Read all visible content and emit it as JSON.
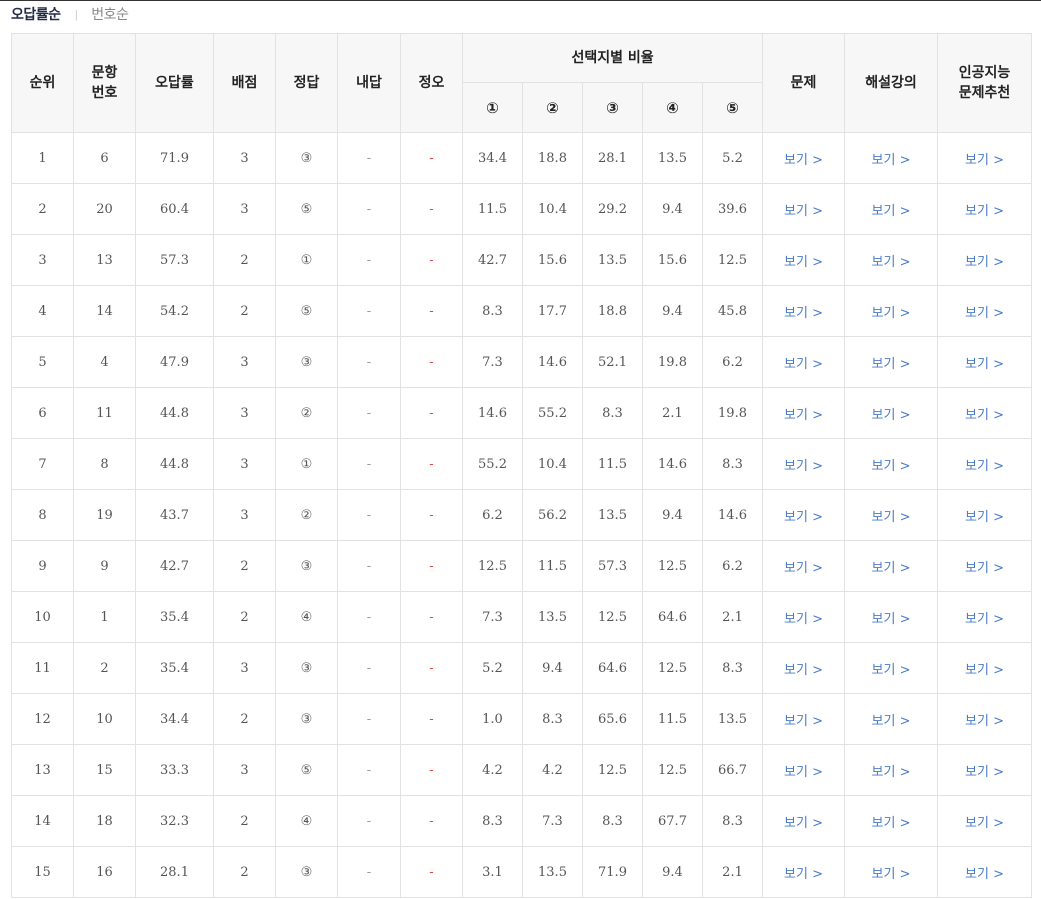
{
  "sort_tabs": {
    "active": "오답률순",
    "separator": "|",
    "inactive": "번호순"
  },
  "headers": {
    "rank": "순위",
    "question_no": "문항\n번호",
    "wrong_rate": "오답률",
    "points": "배점",
    "answer": "정답",
    "my_answer": "내답",
    "correctness": "정오",
    "choice_ratio": "선택지별 비율",
    "choices": [
      "①",
      "②",
      "③",
      "④",
      "⑤"
    ],
    "problem": "문제",
    "lecture": "해설강의",
    "ai_recommend": "인공지능\n문제추천"
  },
  "link_label": "보기 >",
  "rows": [
    {
      "rank": "1",
      "q": "6",
      "wrong": "71.9",
      "pts": "3",
      "ans": "③",
      "mine": "-",
      "ox": "-",
      "r": [
        "34.4",
        "18.8",
        "28.1",
        "13.5",
        "5.2"
      ]
    },
    {
      "rank": "2",
      "q": "20",
      "wrong": "60.4",
      "pts": "3",
      "ans": "⑤",
      "mine": "-",
      "ox": "-",
      "r": [
        "11.5",
        "10.4",
        "29.2",
        "9.4",
        "39.6"
      ]
    },
    {
      "rank": "3",
      "q": "13",
      "wrong": "57.3",
      "pts": "2",
      "ans": "①",
      "mine": "-",
      "ox": "-",
      "r": [
        "42.7",
        "15.6",
        "13.5",
        "15.6",
        "12.5"
      ]
    },
    {
      "rank": "4",
      "q": "14",
      "wrong": "54.2",
      "pts": "2",
      "ans": "⑤",
      "mine": "-",
      "ox": "-",
      "r": [
        "8.3",
        "17.7",
        "18.8",
        "9.4",
        "45.8"
      ]
    },
    {
      "rank": "5",
      "q": "4",
      "wrong": "47.9",
      "pts": "3",
      "ans": "③",
      "mine": "-",
      "ox": "-",
      "r": [
        "7.3",
        "14.6",
        "52.1",
        "19.8",
        "6.2"
      ]
    },
    {
      "rank": "6",
      "q": "11",
      "wrong": "44.8",
      "pts": "3",
      "ans": "②",
      "mine": "-",
      "ox": "-",
      "r": [
        "14.6",
        "55.2",
        "8.3",
        "2.1",
        "19.8"
      ]
    },
    {
      "rank": "7",
      "q": "8",
      "wrong": "44.8",
      "pts": "3",
      "ans": "①",
      "mine": "-",
      "ox": "-",
      "r": [
        "55.2",
        "10.4",
        "11.5",
        "14.6",
        "8.3"
      ]
    },
    {
      "rank": "8",
      "q": "19",
      "wrong": "43.7",
      "pts": "3",
      "ans": "②",
      "mine": "-",
      "ox": "-",
      "r": [
        "6.2",
        "56.2",
        "13.5",
        "9.4",
        "14.6"
      ]
    },
    {
      "rank": "9",
      "q": "9",
      "wrong": "42.7",
      "pts": "2",
      "ans": "③",
      "mine": "-",
      "ox": "-",
      "r": [
        "12.5",
        "11.5",
        "57.3",
        "12.5",
        "6.2"
      ]
    },
    {
      "rank": "10",
      "q": "1",
      "wrong": "35.4",
      "pts": "2",
      "ans": "④",
      "mine": "-",
      "ox": "-",
      "r": [
        "7.3",
        "13.5",
        "12.5",
        "64.6",
        "2.1"
      ]
    },
    {
      "rank": "11",
      "q": "2",
      "wrong": "35.4",
      "pts": "3",
      "ans": "③",
      "mine": "-",
      "ox": "-",
      "r": [
        "5.2",
        "9.4",
        "64.6",
        "12.5",
        "8.3"
      ]
    },
    {
      "rank": "12",
      "q": "10",
      "wrong": "34.4",
      "pts": "2",
      "ans": "③",
      "mine": "-",
      "ox": "-",
      "r": [
        "1.0",
        "8.3",
        "65.6",
        "11.5",
        "13.5"
      ]
    },
    {
      "rank": "13",
      "q": "15",
      "wrong": "33.3",
      "pts": "3",
      "ans": "⑤",
      "mine": "-",
      "ox": "-",
      "r": [
        "4.2",
        "4.2",
        "12.5",
        "12.5",
        "66.7"
      ]
    },
    {
      "rank": "14",
      "q": "18",
      "wrong": "32.3",
      "pts": "2",
      "ans": "④",
      "mine": "-",
      "ox": "-",
      "r": [
        "8.3",
        "7.3",
        "8.3",
        "67.7",
        "8.3"
      ]
    },
    {
      "rank": "15",
      "q": "16",
      "wrong": "28.1",
      "pts": "2",
      "ans": "③",
      "mine": "-",
      "ox": "-",
      "r": [
        "3.1",
        "13.5",
        "71.9",
        "9.4",
        "2.1"
      ]
    }
  ],
  "colors": {
    "link": "#4a7bc8",
    "correctness_dash": "#e04343",
    "header_bg": "#f7f7f7",
    "border": "#e2e2e2",
    "active_tab": "#222a44"
  }
}
